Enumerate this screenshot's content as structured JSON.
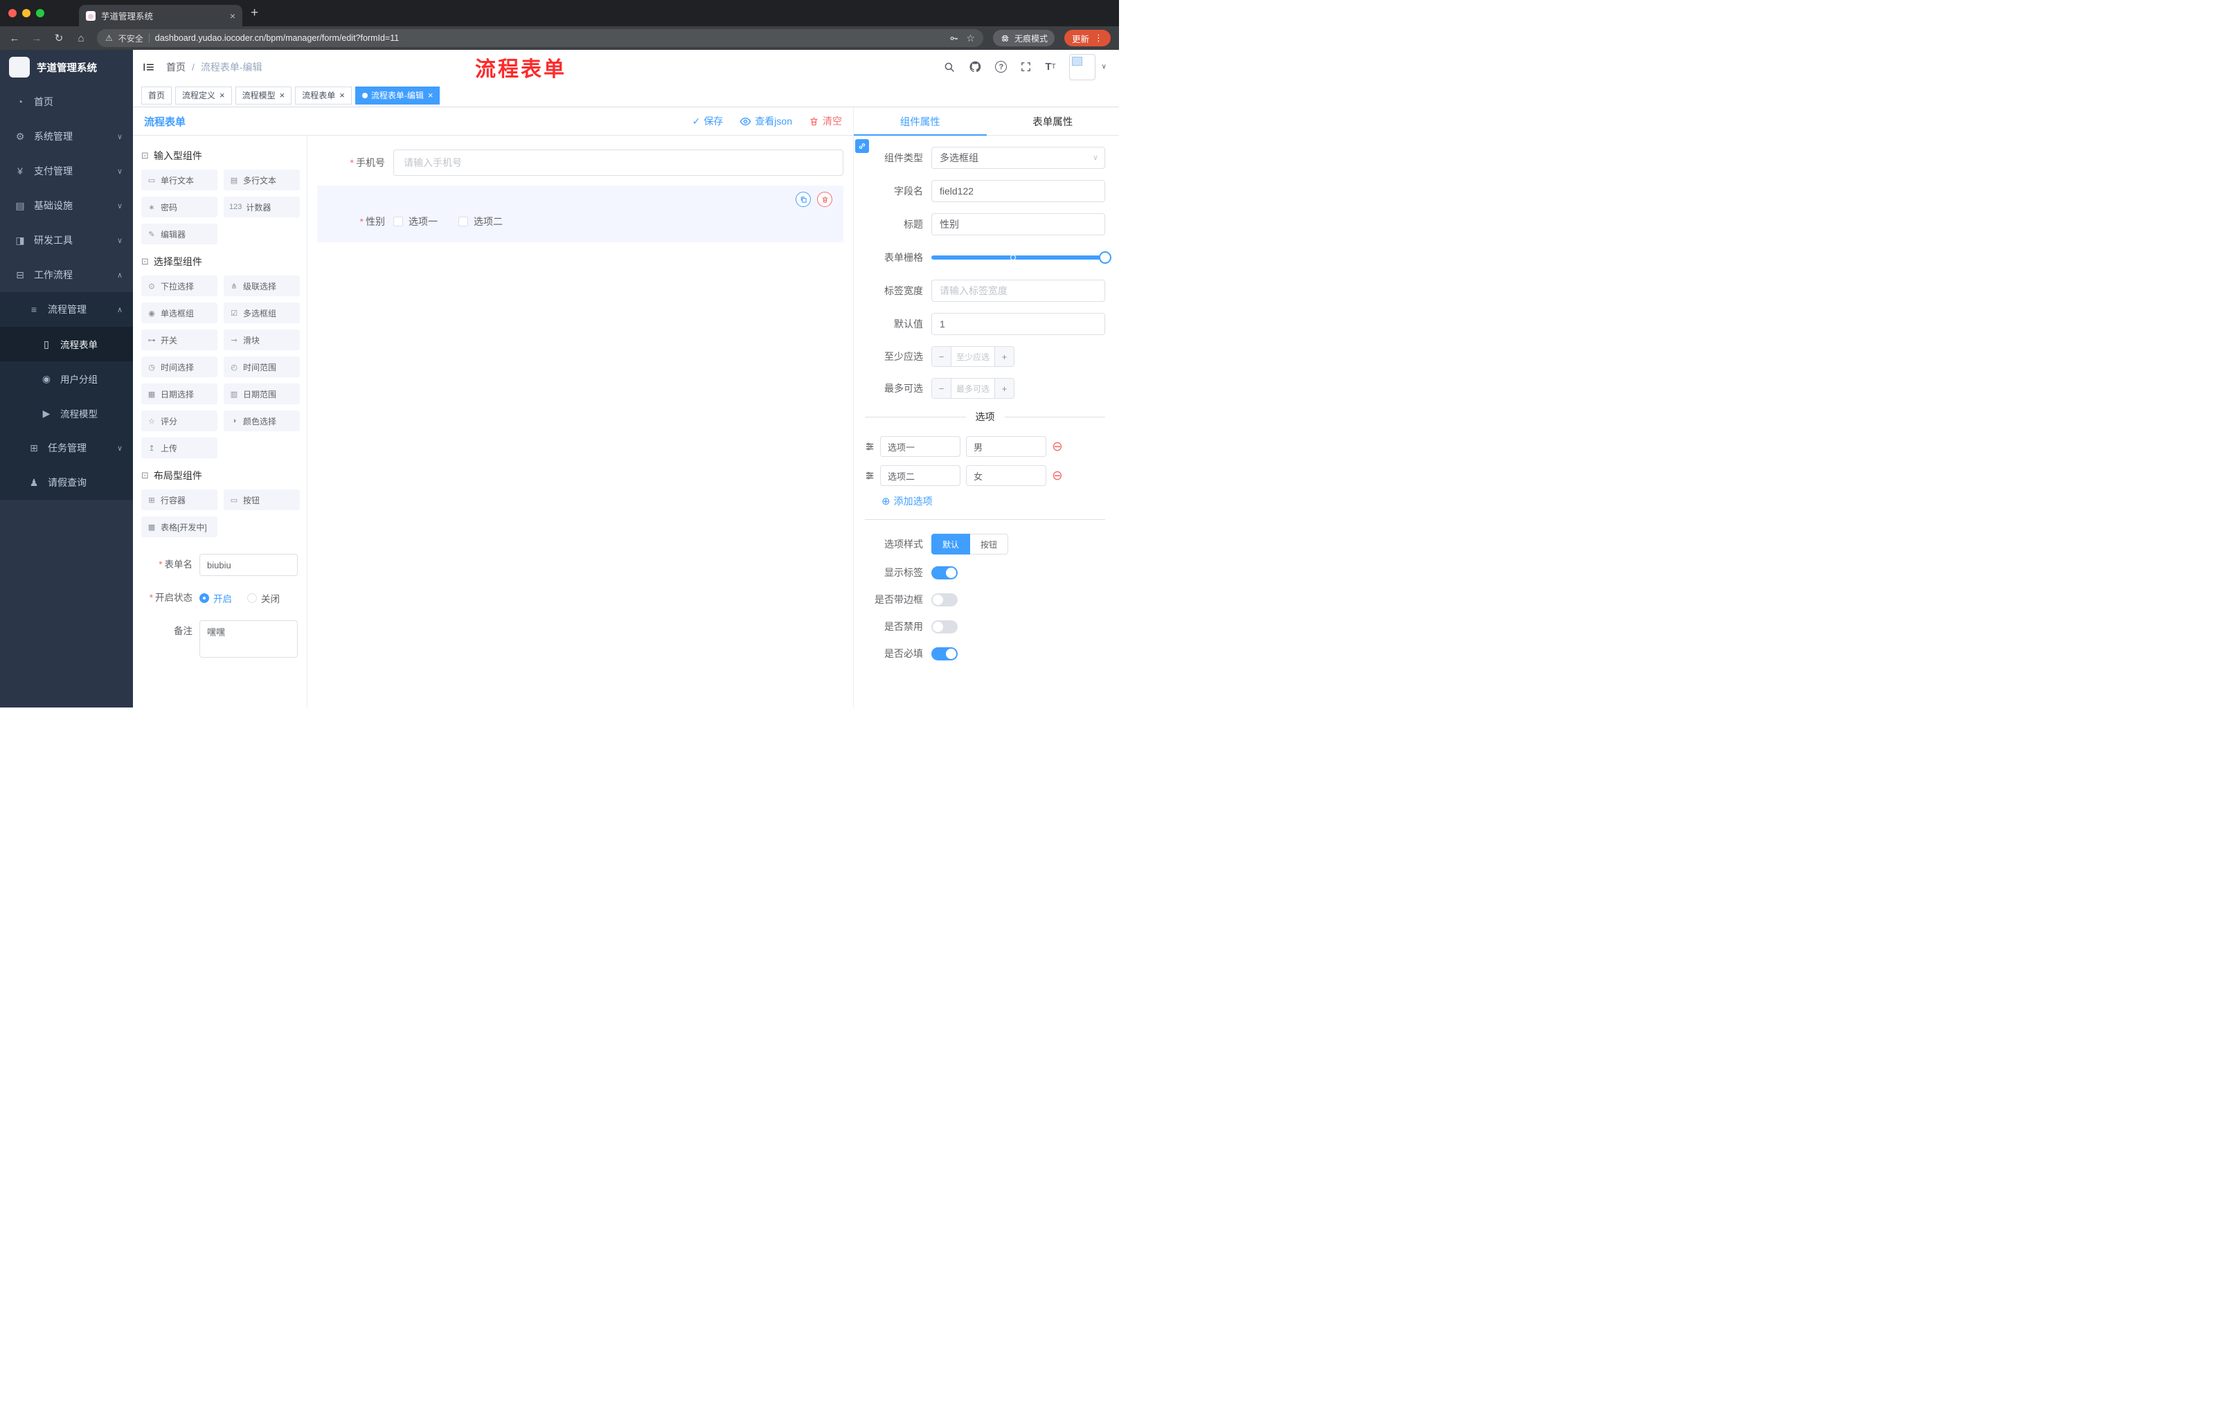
{
  "colors": {
    "accent": "#409eff",
    "danger": "#f56c6c",
    "title_red": "#fd2b2b",
    "update_pill": "#dd5335",
    "sidebar_bg": "#2b3648"
  },
  "glyphs": {
    "close": "×",
    "plus": "+",
    "back": "←",
    "forward": "→",
    "reload": "↻",
    "home": "⌂",
    "warning": "⚠",
    "star": "☆",
    "kebab": "⋮",
    "check": "✓",
    "chevron_down": "∨",
    "minus": "−",
    "add_circle": "⊕",
    "remove_circle": "⊖",
    "question": "?",
    "asterisk": "*",
    "font_big": "T",
    "font_small": "T"
  },
  "browser": {
    "tab_title": "芋道管理系统",
    "url": "dashboard.yudao.iocoder.cn/bpm/manager/form/edit?formId=11",
    "security_label": "不安全",
    "incognito_label": "无痕模式",
    "update_label": "更新"
  },
  "sidebar": {
    "logo_title": "芋道管理系统",
    "items": [
      {
        "icon": "◔",
        "label": "首页"
      },
      {
        "icon": "⚙",
        "label": "系统管理",
        "chevron": "∨"
      },
      {
        "icon": "¥",
        "label": "支付管理",
        "chevron": "∨"
      },
      {
        "icon": "▤",
        "label": "基础设施",
        "chevron": "∨"
      },
      {
        "icon": "◨",
        "label": "研发工具",
        "chevron": "∨"
      },
      {
        "icon": "⊟",
        "label": "工作流程",
        "chevron": "∧"
      },
      {
        "icon": "≡",
        "label": "流程管理",
        "chevron": "∧"
      },
      {
        "icon": "▯",
        "label": "流程表单"
      },
      {
        "icon": "◉",
        "label": "用户分组"
      },
      {
        "icon": "▶",
        "label": "流程模型"
      },
      {
        "icon": "⊞",
        "label": "任务管理",
        "chevron": "∨"
      },
      {
        "icon": "♟",
        "label": "请假查询"
      }
    ]
  },
  "header": {
    "breadcrumb": [
      "首页",
      "流程表单-编辑"
    ],
    "separator": "/",
    "big_title": "流程表单"
  },
  "tags": [
    {
      "label": "首页"
    },
    {
      "label": "流程定义"
    },
    {
      "label": "流程模型"
    },
    {
      "label": "流程表单"
    },
    {
      "label": "流程表单-编辑"
    }
  ],
  "designer": {
    "panel_title": "流程表单",
    "actions": {
      "save": "保存",
      "view_json": "查看json",
      "clear": "清空"
    },
    "palette": {
      "sections": [
        {
          "title": "输入型组件",
          "items": [
            {
              "icon": "▭",
              "label": "单行文本"
            },
            {
              "icon": "▤",
              "label": "多行文本"
            },
            {
              "icon": "∗",
              "label": "密码"
            },
            {
              "icon": "123",
              "label": "计数器"
            },
            {
              "icon": "✎",
              "label": "编辑器"
            }
          ]
        },
        {
          "title": "选择型组件",
          "items": [
            {
              "icon": "⊙",
              "label": "下拉选择"
            },
            {
              "icon": "⋔",
              "label": "级联选择"
            },
            {
              "icon": "◉",
              "label": "单选框组"
            },
            {
              "icon": "☑",
              "label": "多选框组"
            },
            {
              "icon": "⊶",
              "label": "开关"
            },
            {
              "icon": "⊸",
              "label": "滑块"
            },
            {
              "icon": "◷",
              "label": "时间选择"
            },
            {
              "icon": "◴",
              "label": "时间范围"
            },
            {
              "icon": "▦",
              "label": "日期选择"
            },
            {
              "icon": "▥",
              "label": "日期范围"
            },
            {
              "icon": "☆",
              "label": "评分"
            },
            {
              "icon": "◑",
              "label": "颜色选择"
            },
            {
              "icon": "↥",
              "label": "上传"
            }
          ]
        },
        {
          "title": "布局型组件",
          "items": [
            {
              "icon": "⊞",
              "label": "行容器"
            },
            {
              "icon": "▭",
              "label": "按钮"
            },
            {
              "icon": "▩",
              "label": "表格[开发中]"
            }
          ]
        }
      ]
    },
    "settings": {
      "form_name_label": "表单名",
      "form_name_value": "biubiu",
      "status_label": "开启状态",
      "status_on": "开启",
      "status_off": "关闭",
      "remark_label": "备注",
      "remark_value": "嘿嘿"
    },
    "canvas": {
      "phone_label": "手机号",
      "phone_placeholder": "请输入手机号",
      "gender_label": "性别",
      "gender_options": [
        "选项一",
        "选项二"
      ]
    }
  },
  "props": {
    "tab_component": "组件属性",
    "tab_form": "表单属性",
    "component_type_label": "组件类型",
    "component_type_value": "多选框组",
    "field_name_label": "字段名",
    "field_name_value": "field122",
    "title_label": "标题",
    "title_value": "性别",
    "grid_label": "表单栅格",
    "label_width_label": "标签宽度",
    "label_width_placeholder": "请输入标签宽度",
    "default_label": "默认值",
    "default_value": "1",
    "min_label": "至少应选",
    "min_placeholder": "至少应选",
    "max_label": "最多可选",
    "max_placeholder": "最多可选",
    "options_divider": "选项",
    "option_rows": [
      {
        "name": "选项一",
        "value": "男"
      },
      {
        "name": "选项二",
        "value": "女"
      }
    ],
    "add_option": "添加选项",
    "style_label": "选项样式",
    "style_default": "默认",
    "style_button": "按钮",
    "switch_rows": [
      {
        "label": "显示标签",
        "on": true
      },
      {
        "label": "是否带边框",
        "on": false
      },
      {
        "label": "是否禁用",
        "on": false
      },
      {
        "label": "是否必填",
        "on": true
      }
    ]
  }
}
